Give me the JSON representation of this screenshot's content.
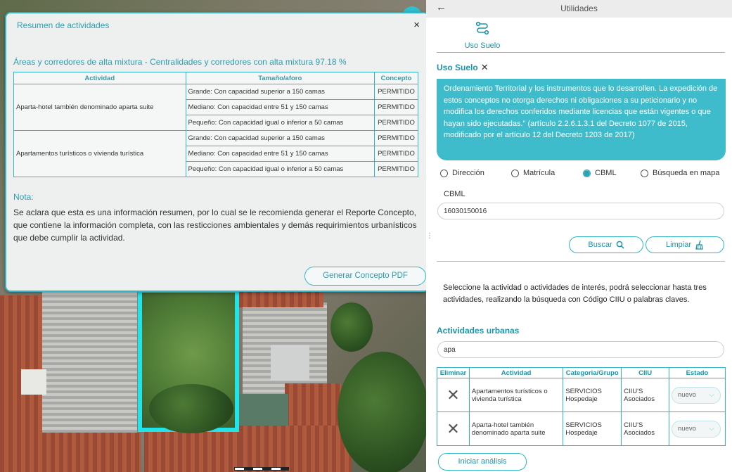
{
  "popup": {
    "title": "Resumen de actividades",
    "close_glyph": "×",
    "subtitle": "Áreas y corredores de alta mixtura - Centralidades y corredores con alta mixtura 97.18 %",
    "columns": [
      "Actividad",
      "Tamaño/aforo",
      "Concepto"
    ],
    "groups": [
      {
        "activity": "Aparta-hotel también denominado aparta suite",
        "rows": [
          {
            "size": "Grande: Con capacidad superior a 150 camas",
            "concept": "PERMITIDO"
          },
          {
            "size": "Mediano: Con capacidad entre 51 y 150 camas",
            "concept": "PERMITIDO"
          },
          {
            "size": "Pequeño: Con capacidad igual o inferior a 50 camas",
            "concept": "PERMITIDO"
          }
        ]
      },
      {
        "activity": "Apartamentos turísticos o vivienda turística",
        "rows": [
          {
            "size": "Grande: Con capacidad superior a 150 camas",
            "concept": "PERMITIDO"
          },
          {
            "size": "Mediano: Con capacidad entre 51 y 150 camas",
            "concept": "PERMITIDO"
          },
          {
            "size": "Pequeño: Con capacidad igual o inferior a 50 camas",
            "concept": "PERMITIDO"
          }
        ]
      }
    ],
    "nota_title": "Nota:",
    "nota_text": "Se aclara que esta es una información resumen, por lo cual se le recomienda generar el Reporte Concepto, que contiene la información completa, con las resticciones ambientales y demás requirimientos urbanísticos que debe cumplir la actividad.",
    "pdf_button": "Generar Concepto PDF"
  },
  "panel": {
    "back_glyph": "←",
    "title": "Utilidades",
    "tab_label": "Uso Suelo",
    "section_title": "Uso Suelo",
    "section_close": "✕",
    "info_text": "Ordenamiento Territorial y los instrumentos que lo desarrollen. La expedición de estos conceptos no otorga derechos ni obligaciones a su peticionario y no modifica los derechos conferidos mediante licencias que están vigentes o que hayan sido ejecutadas.\" (artículo 2.2.6.1.3.1 del Decreto 1077 de 2015, modificado por el artículo 12 del Decreto 1203 de 2017)",
    "search_modes": [
      {
        "label": "Dirección",
        "selected": false
      },
      {
        "label": "Matrícula",
        "selected": false
      },
      {
        "label": "CBML",
        "selected": true
      },
      {
        "label": "Búsqueda en mapa",
        "selected": false
      }
    ],
    "cbml_label": "CBML",
    "cbml_value": "16030150016",
    "buscar_label": "Buscar",
    "limpiar_label": "Limpiar",
    "intro_text": "Seleccione la actividad o actividades de interés, podrá seleccionar hasta tres actividades, realizando la búsqueda con Código CIIU o palabras claves.",
    "activities_title": "Actividades urbanas",
    "activity_search_value": "apa",
    "table_columns": [
      "Eliminar",
      "Actividad",
      "Categoria/Grupo",
      "CIIU",
      "Estado"
    ],
    "table_rows": [
      {
        "delete": "✕",
        "activity": "Apartamentos turísticos o vivienda turística",
        "category": "SERVICIOS Hospedaje",
        "ciiu": "CIIU'S Asociados",
        "estado": "nuevo"
      },
      {
        "delete": "✕",
        "activity": "Aparta-hotel también denominado aparta suite",
        "category": "SERVICIOS Hospedaje",
        "ciiu": "CIIU'S Asociados",
        "estado": "nuevo"
      }
    ],
    "start_button": "Iniciar análisis"
  },
  "colors": {
    "accent": "#2fb5c3",
    "accent_text": "#1e93a8",
    "lot_outline": "#21e4e9",
    "info_bg": "#3fbccb"
  }
}
